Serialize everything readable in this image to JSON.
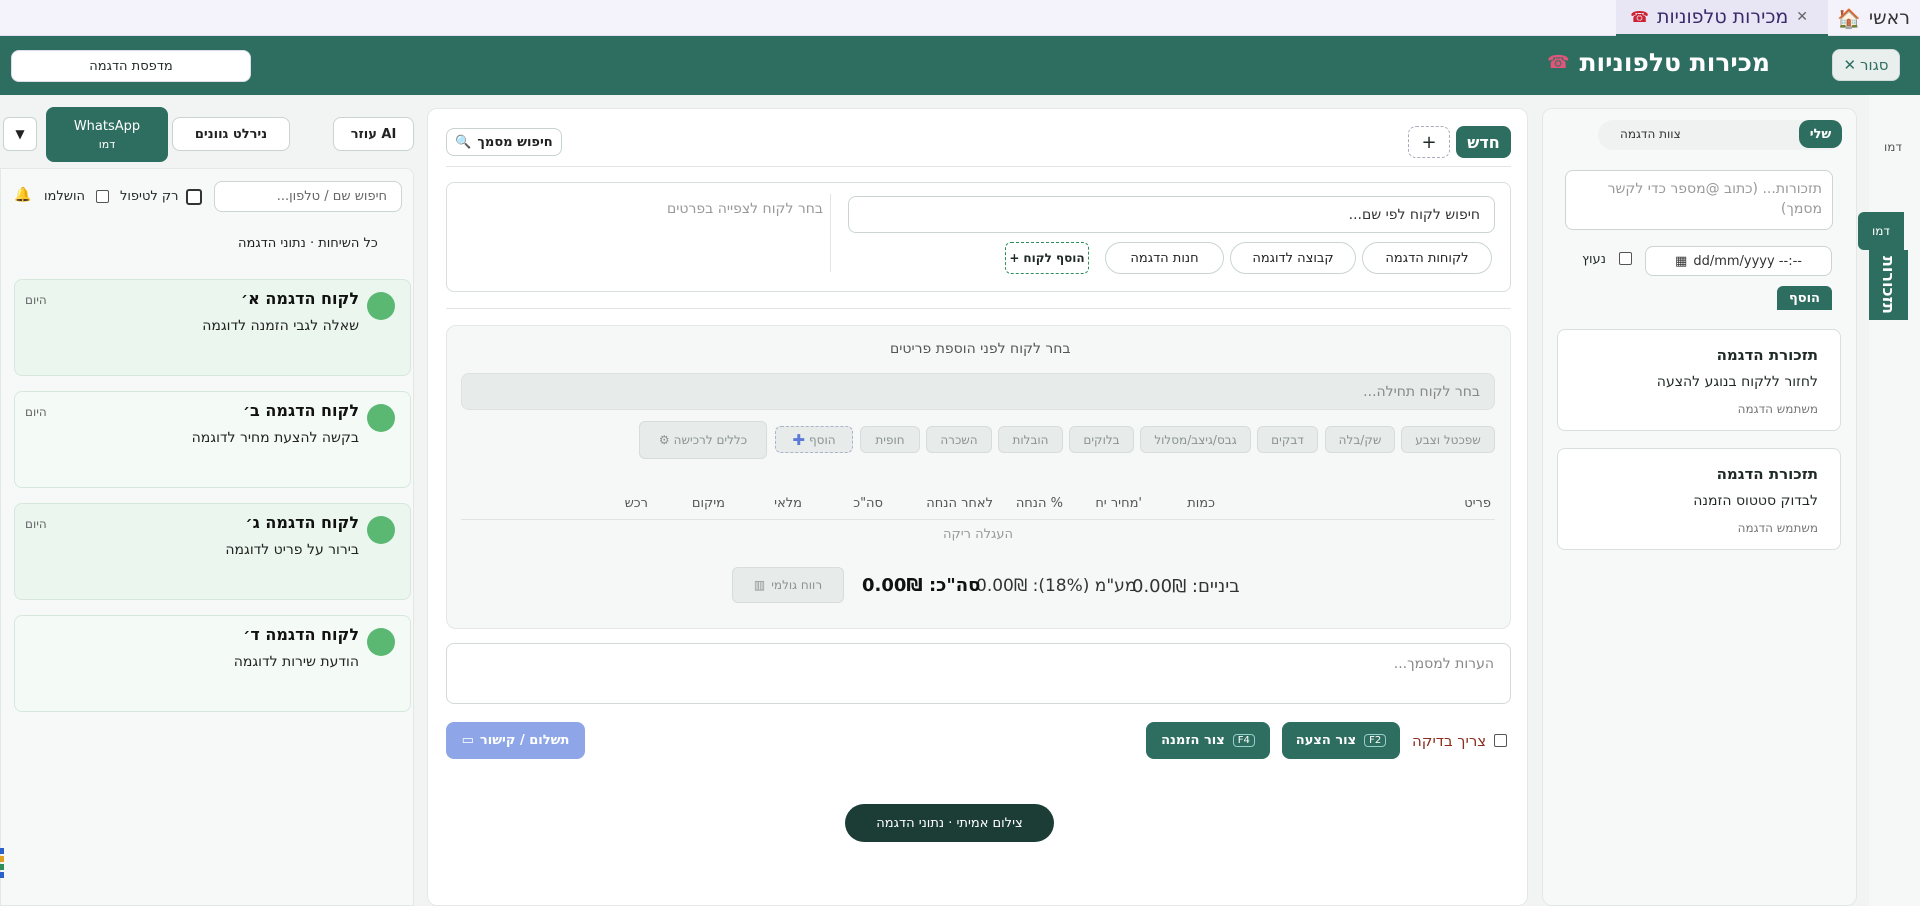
{
  "tabs": [
    {
      "label": "ראשי",
      "icon": "home-icon"
    },
    {
      "label": "מכירות טלפוניות",
      "icon": "phone-icon"
    }
  ],
  "header": {
    "title": "מכירות טלפוניות",
    "close_label": "סגור",
    "printer_label": "מדפסת הדגמה"
  },
  "right_panel": {
    "side_tab_demo1": "דמו",
    "side_tab_demo2": "דמו",
    "side_tab_vertical": "תזכורות",
    "filter_mine": "שלי",
    "filter_team": "צוות הדגמה",
    "reminder_placeholder": "תזכורות... (כתוב @מספר כדי לקשר מסמך)",
    "date_value": "dd/mm/yyyy  --:--",
    "pinned_label": "נעוץ",
    "add_label": "הוסף",
    "reminders": [
      {
        "title": "תזכורת הדגמה",
        "desc": "לחזור ללקוח בנוגע להצעה",
        "user": "משתמש הדגמה"
      },
      {
        "title": "תזכורת הדגמה",
        "desc": "לבדוק סטטוס הזמנה",
        "user": "משתמש הדגמה"
      }
    ]
  },
  "main": {
    "new_label": "חדש",
    "plus_label": "+",
    "doc_search_label": "חיפוש מסמך",
    "customer_search_placeholder": "חיפוש לקוח לפי שם...",
    "customer_hint": "בחר לקוח לצפייה בפרטים",
    "customer_buttons": [
      "לקוחות הדגמה",
      "קבוצה לדוגמה",
      "חנות הדגמה"
    ],
    "add_customer_label": "הוסף לקוח",
    "items_hint": "בחר לקוח לפני הוספת פריטים",
    "items_placeholder": "בחר לקוח תחילה...",
    "item_chips": [
      "שפכטל וצבע",
      "שק/בלה",
      "דבקים",
      "גבס/גיצב/מסלול",
      "בלוקים",
      "הובלות",
      "השכרה",
      "חופית"
    ],
    "add_item_label": "הוסף",
    "tools_label": "כללים לרכישה",
    "columns": [
      "פריט",
      "כמות",
      "מחיר יח'",
      "הנחה %",
      "לאחר הנחה",
      "סה\"כ",
      "מלאי",
      "מיקום",
      "רכש"
    ],
    "empty_label": "העגלה ריקה",
    "subtotal_label": "ביניים: 0.00₪",
    "vat_label": "מע\"מ (18%): 0.00₪",
    "total_label": "סה\"כ: 0.00₪",
    "gross_label": "רווח גולמי",
    "notes_placeholder": "הערות למסמך...",
    "needs_check_label": "צריך בדיקה",
    "create_quote_label": "צור הצעה",
    "create_quote_key": "F2",
    "create_order_label": "צור הזמנה",
    "create_order_key": "F4",
    "payment_label": "תשלום / קישור",
    "photo_label": "צילום אמיתי · נתוני הדגמה"
  },
  "left_panel": {
    "tab_ai": "עוזר AI",
    "tab_nirlat": "נירלט גוונים",
    "tab_whatsapp": "WhatsApp",
    "tab_whatsapp_sub": "דמו",
    "dropdown_glyph": "▼",
    "search_placeholder": "חיפוש שם / טלפון...",
    "only_unhandled": "רק לטיפול",
    "completed": "הושלמו",
    "all_chats": "כל השיחות · נתוני הדגמה",
    "conversations": [
      {
        "name": "לקוח הדגמה א׳",
        "msg": "שאלה לגבי הזמנה לדוגמה",
        "time": "היום"
      },
      {
        "name": "לקוח הדגמה ב׳",
        "msg": "בקשה להצעת מחיר לדוגמה",
        "time": "היום"
      },
      {
        "name": "לקוח הדגמה ג׳",
        "msg": "בירור על פריט לדוגמה",
        "time": "היום"
      },
      {
        "name": "לקוח הדגמה ד׳",
        "msg": "הודעת שירות לדוגמה",
        "time": ""
      }
    ]
  },
  "colors": {
    "brand": "#2e6e60",
    "accent_blue": "#8ea6e8",
    "chat_bg": "#eaf6ee"
  }
}
